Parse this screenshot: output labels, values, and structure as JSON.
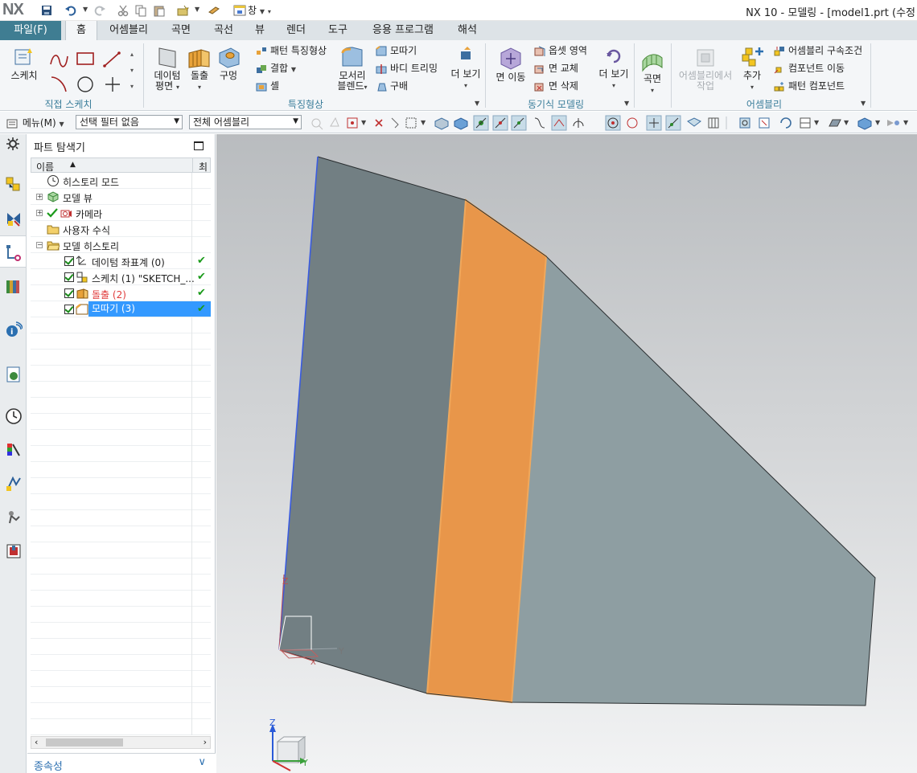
{
  "app": {
    "logo": "NX",
    "window_menu": "창",
    "title": "NX 10 - 모델링 - [model1.prt (수정"
  },
  "tabs": {
    "file": "파일(F)",
    "items": [
      "홈",
      "어셈블리",
      "곡면",
      "곡선",
      "뷰",
      "렌더",
      "도구",
      "응용 프로그램",
      "해석"
    ],
    "active_index": 0
  },
  "ribbon": {
    "sketch": "스케치",
    "direct_sketch_group": "직접 스케치",
    "datum_plane": [
      "데이텀",
      "평면"
    ],
    "extrude": "돌출",
    "hole": "구멍",
    "pattern_feature": "패턴 특징형상",
    "unite": "결합",
    "shell": "셸",
    "edge_blend": [
      "모서리",
      "블렌드"
    ],
    "chamfer": "모따기",
    "trim_body": "바디 트리밍",
    "draft": "구배",
    "more_feature": "더 보기",
    "feature_group": "특징형상",
    "move_face": "면 이동",
    "offset_region": "옵셋 영역",
    "replace_face": "면 교체",
    "delete_face": "면 삭제",
    "more_sync": "더 보기",
    "sync_group": "동기식 모델링",
    "surface": "곡면",
    "work_in_assembly": [
      "어셈블리에서",
      "작업"
    ],
    "add": "추가",
    "assembly_constraints": "어셈블리 구속조건",
    "move_component": "컴포넌트 이동",
    "pattern_component": "패턴 컴포넌트",
    "assembly_group": "어셈블리"
  },
  "selection_bar": {
    "menu": "메뉴(M)",
    "filter": "선택 필터 없음",
    "scope": "전체 어셈블리"
  },
  "navigator": {
    "title": "파트 탐색기",
    "col_name": "이름",
    "col_last": "최",
    "items": [
      {
        "label": "히스토리 모드"
      },
      {
        "label": "모델 뷰"
      },
      {
        "label": "카메라"
      },
      {
        "label": "사용자 수식"
      },
      {
        "label": "모델 히스토리"
      },
      {
        "label": "데이텀 좌표계 (0)"
      },
      {
        "label": "스케치 (1) \"SKETCH_..."
      },
      {
        "label": "돌출 (2)"
      },
      {
        "label": "모따기 (3)"
      }
    ],
    "dependencies": "종속성"
  },
  "viewport": {
    "axis_z": "Z",
    "axis_y": "Y",
    "axis_x": "X"
  },
  "colors": {
    "accent": "#3f7d92",
    "selected_face": "#e8964a",
    "body_dark": "#727f83",
    "body_light": "#8e9ea2",
    "selection": "#3399ff"
  }
}
